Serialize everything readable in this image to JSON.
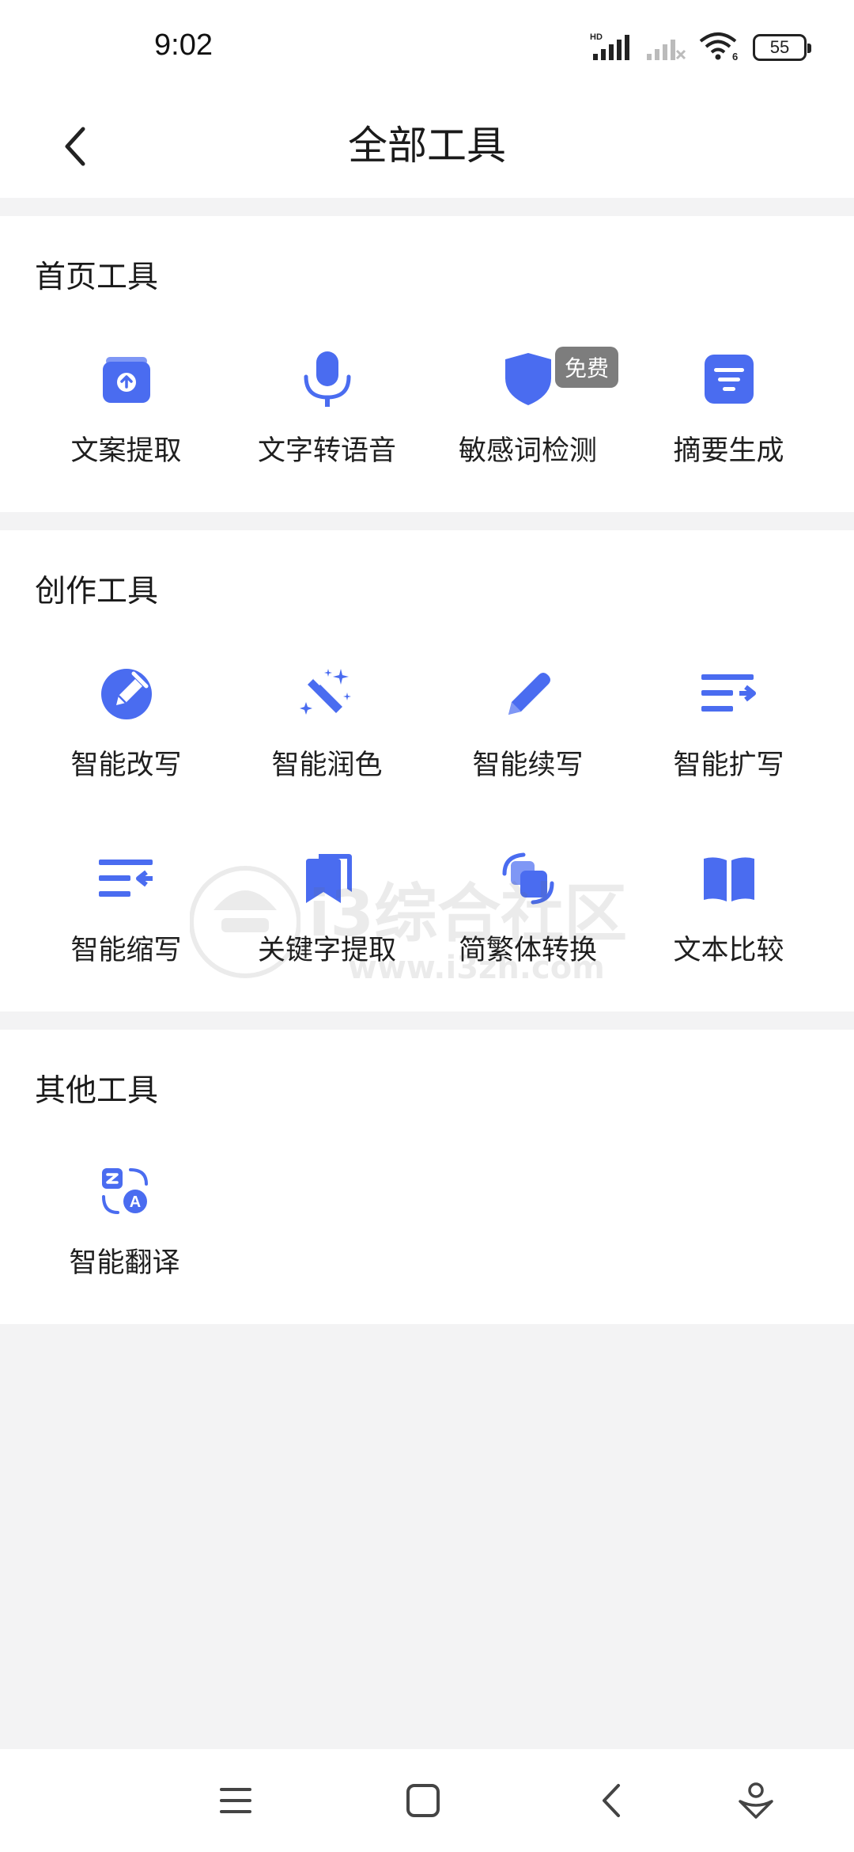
{
  "status_bar": {
    "time": "9:02",
    "battery": "55",
    "network_badge": "HD",
    "wifi_badge": "6"
  },
  "header": {
    "title": "全部工具",
    "back_icon": "chevron-left-icon"
  },
  "sections": [
    {
      "title": "首页工具",
      "tools": [
        {
          "label": "文案提取",
          "icon": "upload-box-icon"
        },
        {
          "label": "文字转语音",
          "icon": "microphone-icon"
        },
        {
          "label": "敏感词检测",
          "icon": "shield-icon",
          "badge": "免费"
        },
        {
          "label": "摘要生成",
          "icon": "summary-list-icon"
        }
      ]
    },
    {
      "title": "创作工具",
      "tools": [
        {
          "label": "智能改写",
          "icon": "edit-circle-icon"
        },
        {
          "label": "智能润色",
          "icon": "magic-wand-icon"
        },
        {
          "label": "智能续写",
          "icon": "pencil-icon"
        },
        {
          "label": "智能扩写",
          "icon": "expand-lines-icon"
        },
        {
          "label": "智能缩写",
          "icon": "shrink-lines-icon"
        },
        {
          "label": "关键字提取",
          "icon": "bookmark-icon"
        },
        {
          "label": "简繁体转换",
          "icon": "convert-squares-icon"
        },
        {
          "label": "文本比较",
          "icon": "open-book-icon"
        }
      ]
    },
    {
      "title": "其他工具",
      "tools": [
        {
          "label": "智能翻译",
          "icon": "translate-icon"
        }
      ]
    }
  ],
  "watermark": {
    "text": "i3综合社区",
    "url": "www.i3zh.com"
  },
  "nav_bar": {
    "icons": [
      "menu-icon",
      "home-square-icon",
      "back-chevron-icon",
      "assistant-icon"
    ]
  },
  "colors": {
    "accent": "#4a6cf0",
    "background": "#f3f3f4",
    "badge": "#7d7d7d"
  }
}
